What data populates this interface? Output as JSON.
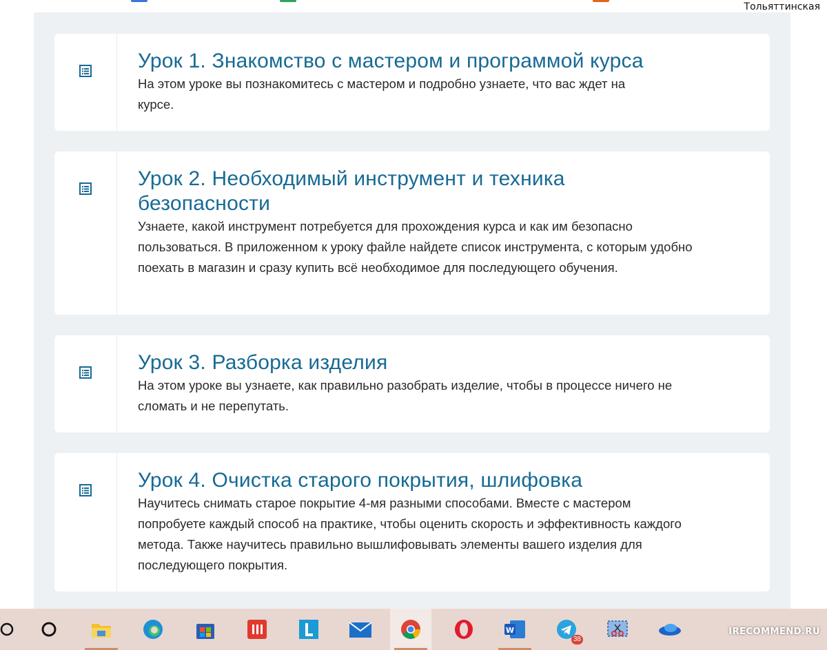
{
  "browser": {
    "location_label": "Тольяттинская"
  },
  "lessons": [
    {
      "title": "Урок 1. Знакомство с мастером и программой курса",
      "description": "На этом уроке вы познакомитесь с мастером и подробно узнаете, что вас ждет на курсе.",
      "icon": "document-list-icon"
    },
    {
      "title": "Урок 2. Необходимый инструмент и техника безопасности",
      "description": "Узнаете, какой инструмент потребуется для прохождения курса и как им безопасно пользоваться. В приложенном к уроку файле найдете список инструмента, с которым удобно поехать в магазин и сразу купить всё необходимое для последующего обучения.",
      "icon": "document-list-icon"
    },
    {
      "title": "Урок 3. Разборка изделия",
      "description": "На этом уроке вы узнаете, как правильно разобрать изделие, чтобы в процессе ничего не сломать и не перепутать.",
      "icon": "document-list-icon"
    },
    {
      "title": "Урок 4. Очистка старого покрытия, шлифовка",
      "description": "Научитесь снимать старое покрытие 4-мя разными способами. Вместе с мастером попробуете каждый способ на практике, чтобы оценить скорость и эффективность каждого метода. Также научитесь правильно вышлифовывать элементы вашего изделия для последующего покрытия.",
      "icon": "document-list-icon"
    }
  ],
  "taskbar": {
    "telegram_badge": "38",
    "watermark": "IRECOMMEND.RU",
    "apps": [
      "search",
      "task-view",
      "file-explorer",
      "edge",
      "store",
      "app-red",
      "lingualeo",
      "mail",
      "chrome",
      "opera",
      "word",
      "telegram",
      "snipping-tool",
      "app-blue"
    ]
  },
  "colors": {
    "accent": "#176a94",
    "content_bg": "#eef1f3",
    "taskbar_bg": "#e8d7d1"
  }
}
